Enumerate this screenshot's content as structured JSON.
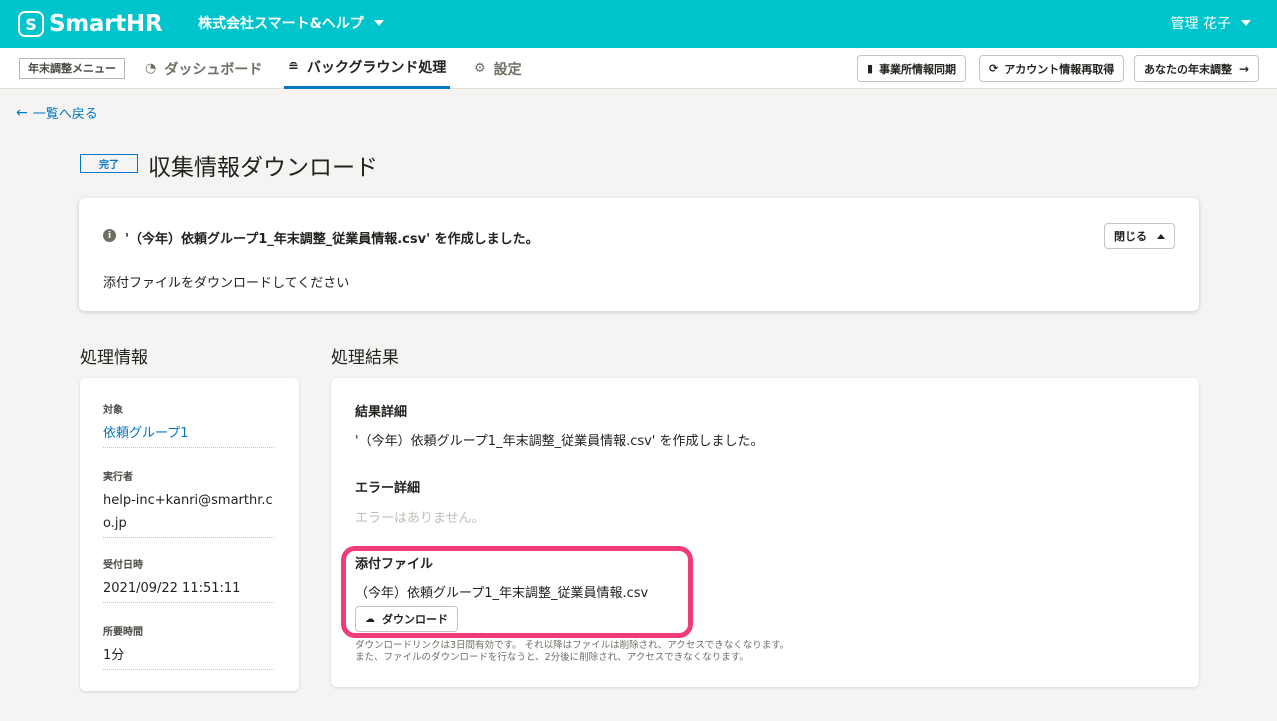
{
  "header": {
    "logo_mark": "S",
    "logo_text": "SmartHR",
    "company": "株式会社スマート&ヘルプ",
    "user": "管理 花子"
  },
  "subnav": {
    "menu_label": "年末調整メニュー",
    "items": [
      {
        "label": "ダッシュボード",
        "icon": "gauge-icon"
      },
      {
        "label": "バックグラウンド処理",
        "icon": "database-icon",
        "active": true
      },
      {
        "label": "設定",
        "icon": "gear-icon"
      }
    ],
    "buttons": [
      {
        "label": "事業所情報同期",
        "icon": "building-icon"
      },
      {
        "label": "アカウント情報再取得",
        "icon": "refresh-icon"
      },
      {
        "label": "あなたの年末調整",
        "icon": "arrow-right-icon"
      }
    ]
  },
  "back_link": "一覧へ戻る",
  "status_badge": "完了",
  "page_title": "収集情報ダウンロード",
  "notice": {
    "heading": "'（今年）依頼グループ1_年末調整_従業員情報.csv' を作成しました。",
    "body": "添付ファイルをダウンロードしてください",
    "close_label": "閉じる"
  },
  "info_section": {
    "title": "処理情報",
    "fields": [
      {
        "label": "対象",
        "value": "依頼グループ1"
      },
      {
        "label": "実行者",
        "value": "help-inc+kanri@smarthr.co.jp"
      },
      {
        "label": "受付日時",
        "value": "2021/09/22 11:51:11"
      },
      {
        "label": "所要時間",
        "value": "1分"
      }
    ]
  },
  "result_section": {
    "title": "処理結果",
    "detail_label": "結果詳細",
    "detail_value": "'（今年）依頼グループ1_年末調整_従業員情報.csv' を作成しました。",
    "error_label": "エラー詳細",
    "error_value": "エラーはありません。",
    "attachment_label": "添付ファイル",
    "attachment_name": "（今年）依頼グループ1_年末調整_従業員情報.csv",
    "download_label": "ダウンロード",
    "note_line1": "ダウンロードリンクは3日間有効です。 それ以降はファイルは削除され、アクセスできなくなります。",
    "note_line2": "また、ファイルのダウンロードを行なうと、2分後に削除され、アクセスできなくなります。"
  },
  "colors": {
    "header_bg": "#00c4cc",
    "link": "#0077c7",
    "highlight": "#f03c78"
  }
}
